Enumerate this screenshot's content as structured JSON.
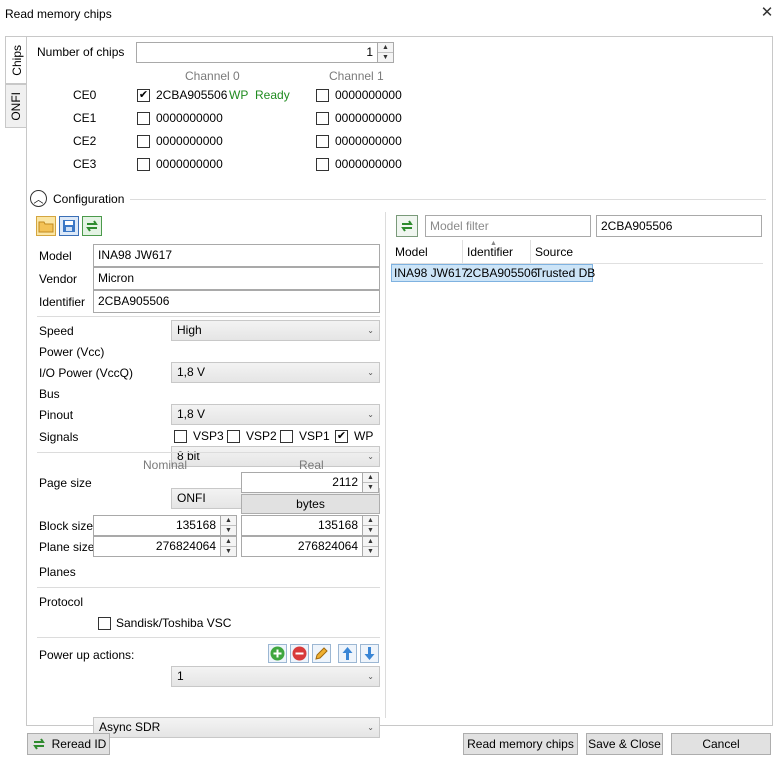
{
  "window": {
    "title": "Read memory chips",
    "close": "✕"
  },
  "tabs": [
    {
      "label": "Chips"
    },
    {
      "label": "ONFI"
    }
  ],
  "chips": {
    "count_label": "Number of chips",
    "count": "1",
    "channel0": "Channel 0",
    "channel1": "Channel 1",
    "rows": [
      {
        "ce": "CE0",
        "ch0": {
          "checked": true,
          "id": "2CBA905506",
          "wp": "WP",
          "status": "Ready"
        },
        "ch1": {
          "checked": false,
          "id": "0000000000"
        }
      },
      {
        "ce": "CE1",
        "ch0": {
          "checked": false,
          "id": "0000000000"
        },
        "ch1": {
          "checked": false,
          "id": "0000000000"
        }
      },
      {
        "ce": "CE2",
        "ch0": {
          "checked": false,
          "id": "0000000000"
        },
        "ch1": {
          "checked": false,
          "id": "0000000000"
        }
      },
      {
        "ce": "CE3",
        "ch0": {
          "checked": false,
          "id": "0000000000"
        },
        "ch1": {
          "checked": false,
          "id": "0000000000"
        }
      }
    ]
  },
  "configuration": {
    "label": "Configuration",
    "model_label": "Model",
    "model": "INA98 JW617",
    "vendor_label": "Vendor",
    "vendor": "Micron",
    "identifier_label": "Identifier",
    "identifier": "2CBA905506",
    "speed_label": "Speed",
    "speed": "High",
    "power_label": "Power (Vcc)",
    "power": "1,8 V",
    "io_power_label": "I/O Power (VccQ)",
    "io_power": "1,8 V",
    "bus_label": "Bus",
    "bus": "8 bit",
    "pinout_label": "Pinout",
    "pinout": "ONFI",
    "signals_label": "Signals",
    "signals": [
      {
        "label": "VSP3",
        "checked": false
      },
      {
        "label": "VSP2",
        "checked": false
      },
      {
        "label": "VSP1",
        "checked": false
      },
      {
        "label": "WP",
        "checked": true
      }
    ],
    "nominal_label": "Nominal",
    "real_label": "Real",
    "page_size_label": "Page size",
    "page_size_real": "2112",
    "units_button": "bytes",
    "block_size_label": "Block size",
    "block_size_nominal": "135168",
    "block_size_real": "135168",
    "plane_size_label": "Plane size",
    "plane_size_nominal": "276824064",
    "plane_size_real": "276824064",
    "planes_label": "Planes",
    "planes": "1",
    "protocol_label": "Protocol",
    "protocol": "Async SDR",
    "sandisk_label": "Sandisk/Toshiba VSC",
    "power_up_label": "Power up actions:"
  },
  "models": {
    "filter_placeholder": "Model filter",
    "id_filter": "2CBA905506",
    "columns": [
      "Model",
      "Identifier",
      "Source"
    ],
    "rows": [
      {
        "model": "INA98 JW617",
        "identifier": "2CBA905506",
        "source": "Trusted DB"
      }
    ]
  },
  "footer": {
    "reread": "Reread ID",
    "read": "Read memory chips",
    "save": "Save & Close",
    "cancel": "Cancel"
  },
  "colors": {
    "accent_green": "#1f8b1f",
    "selection": "#cce4f7"
  }
}
